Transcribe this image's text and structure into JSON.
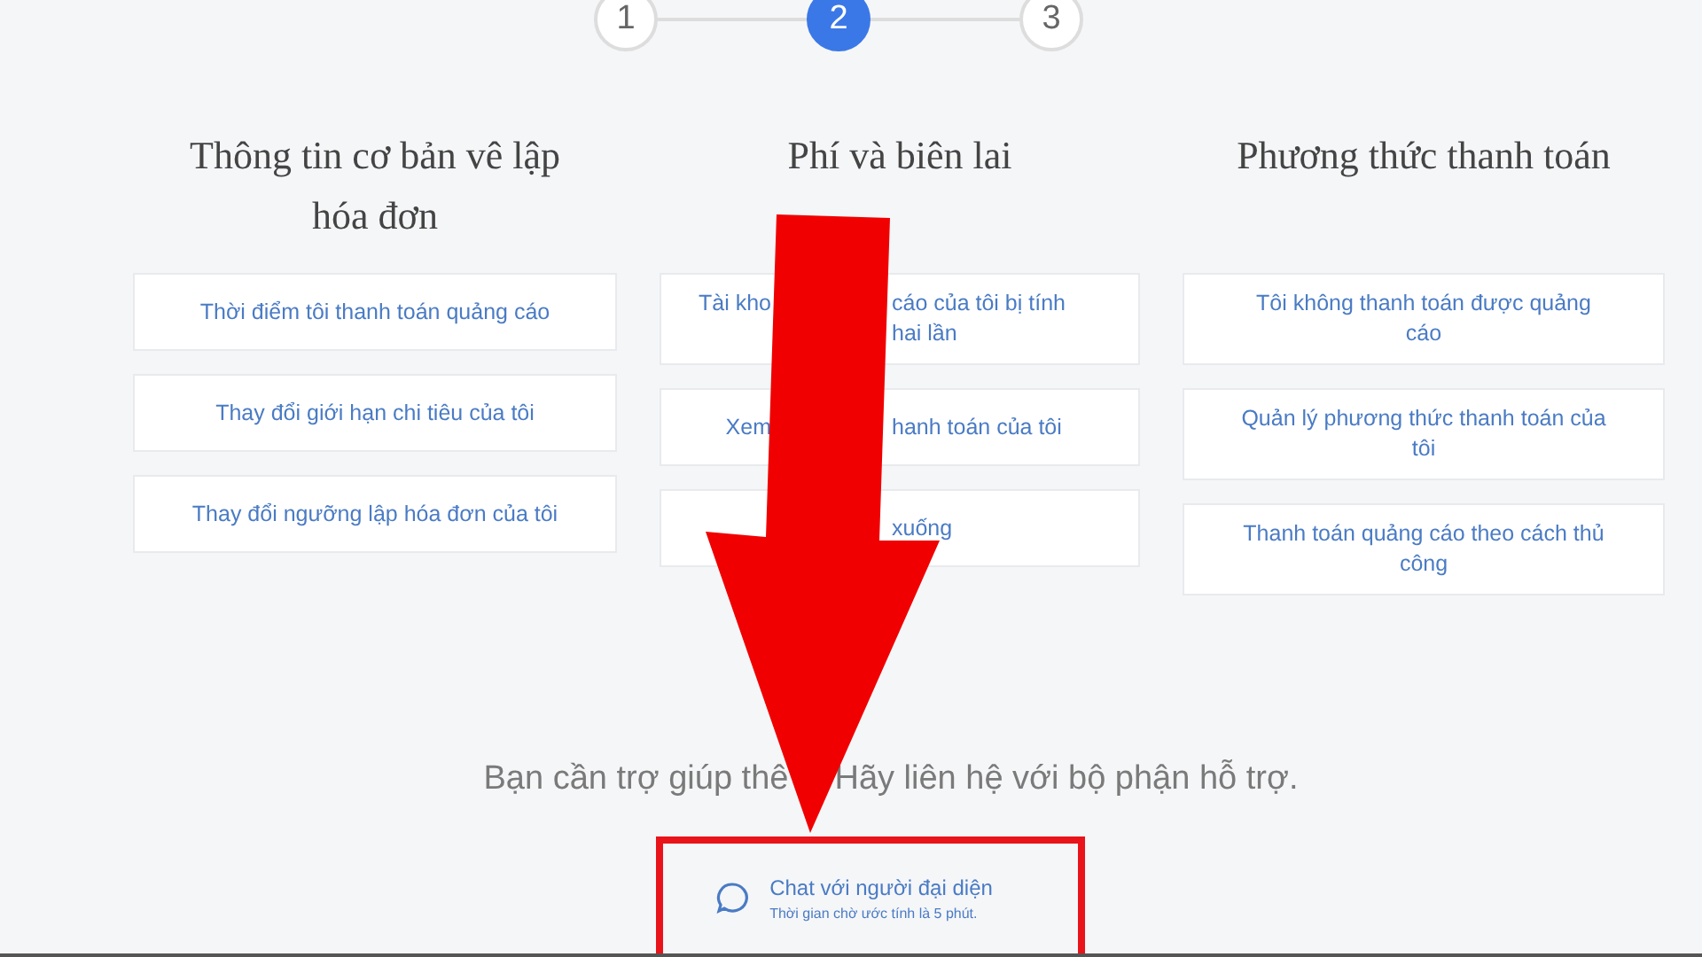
{
  "steps": [
    {
      "label": "1",
      "selected": false
    },
    {
      "label": "2",
      "selected": true
    },
    {
      "label": "3",
      "selected": false
    }
  ],
  "columns": [
    {
      "heading": "Thông tin cơ bản vê lập hóa đơn",
      "cards": [
        {
          "kind": "full",
          "text": "Thời điểm tôi thanh toán quảng cáo"
        },
        {
          "kind": "full",
          "text": "Thay đổi giới hạn chi tiêu của tôi"
        },
        {
          "kind": "full",
          "text": "Thay đổi ngưỡng lập hóa đơn của tôi"
        }
      ]
    },
    {
      "heading": "Phí và biên lai",
      "cards": [
        {
          "kind": "covered",
          "lines": [
            {
              "left": "Tài kho",
              "right": "cáo của tôi bị tính"
            },
            {
              "right": "hai lần"
            }
          ]
        },
        {
          "kind": "covered",
          "lines": [
            {
              "left": "Xem",
              "right": "hanh toán của tôi"
            }
          ]
        },
        {
          "kind": "covered",
          "lines": [
            {
              "right": "xuống"
            }
          ]
        }
      ]
    },
    {
      "heading": "Phương thức thanh toán",
      "cards": [
        {
          "kind": "full",
          "text": "Tôi không thanh toán được quảng cáo"
        },
        {
          "kind": "full",
          "text": "Quản lý phương thức thanh toán của tôi"
        },
        {
          "kind": "full",
          "text": "Thanh toán quảng cáo theo cách thủ công"
        }
      ]
    }
  ],
  "help": {
    "before": "Bạn cần trợ giúp thê",
    "after": "Hãy liên hệ với bộ phận hỗ trợ."
  },
  "chat": {
    "title": "Chat với người đại diện",
    "subtitle": "Thời gian chờ ước tính là 5 phút."
  }
}
